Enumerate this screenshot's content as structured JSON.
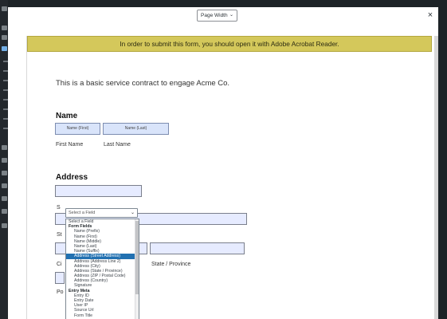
{
  "toolbar": {
    "zoom_value": "Page Width",
    "zoom_caret": "⌄",
    "close_label": "×"
  },
  "banner": {
    "text": "In order to submit this form, you should open it with Adobe Acrobat Reader."
  },
  "document": {
    "intro": "This is a basic service contract to engage Acme Co.",
    "name_section": {
      "title": "Name",
      "first_placeholder": "Name (First)",
      "last_placeholder": "Name (Last)",
      "first_label": "First Name",
      "last_label": "Last Name"
    },
    "address_section": {
      "title": "Address",
      "partial_s1": "S",
      "partial_st": "St",
      "partial_ci": "Ci",
      "state_label": "State / Province",
      "partial_po": "Po"
    }
  },
  "field_picker": {
    "selected": "Select a Field",
    "caret": "⌄",
    "options": [
      {
        "label": "Select a Field",
        "kind": "top"
      },
      {
        "label": "Form Fields",
        "kind": "group"
      },
      {
        "label": "Name (Prefix)",
        "kind": "item"
      },
      {
        "label": "Name (First)",
        "kind": "item"
      },
      {
        "label": "Name (Middle)",
        "kind": "item"
      },
      {
        "label": "Name (Last)",
        "kind": "item"
      },
      {
        "label": "Name (Suffix)",
        "kind": "item"
      },
      {
        "label": "Address (Street Address)",
        "kind": "selected"
      },
      {
        "label": "Address (Address Line 2)",
        "kind": "item"
      },
      {
        "label": "Address (City)",
        "kind": "item"
      },
      {
        "label": "Address (State / Province)",
        "kind": "item"
      },
      {
        "label": "Address (ZIP / Postal Code)",
        "kind": "item"
      },
      {
        "label": "Address (Country)",
        "kind": "item"
      },
      {
        "label": "Signature",
        "kind": "item"
      },
      {
        "label": "Entry Meta",
        "kind": "group"
      },
      {
        "label": "Entry ID",
        "kind": "item"
      },
      {
        "label": "Entry Date",
        "kind": "item"
      },
      {
        "label": "User IP",
        "kind": "item"
      },
      {
        "label": "Source Url",
        "kind": "item"
      },
      {
        "label": "Form Title",
        "kind": "item"
      }
    ]
  }
}
